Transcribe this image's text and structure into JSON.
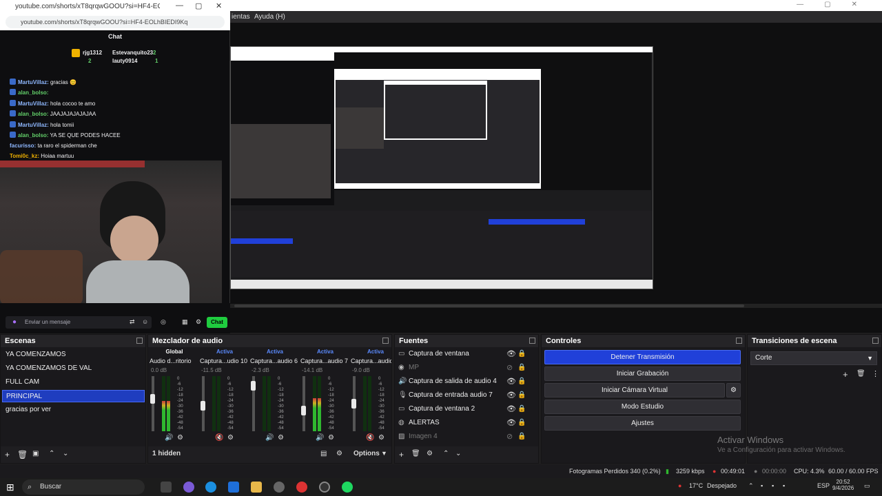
{
  "browser": {
    "url_top": "youtube.com/shorts/xT8qrqwGOOU?si=HF4-EOLhBIEDI9Kq",
    "url": "youtube.com/shorts/xT8qrqwGOOU?si=HF4-EOLhBIEDI9Kq",
    "chat_title": "Chat",
    "subs": [
      {
        "name": "rjg1312",
        "count": "2"
      },
      {
        "name": "Estevanquito23",
        "count": "2"
      },
      {
        "name": "lauty0914",
        "count": "1"
      }
    ],
    "messages": [
      {
        "user": "MartuVillaz:",
        "text": "gracias 😊",
        "green": false
      },
      {
        "user": "alan_bolso:",
        "text": "",
        "green": true
      },
      {
        "user": "MartuVillaz:",
        "text": "hola cocoo te amo",
        "green": false
      },
      {
        "user": "alan_bolso:",
        "text": "JAAJAJAJAJAJAA",
        "green": true
      },
      {
        "user": "MartuVillaz:",
        "text": "hola tomii",
        "green": false
      },
      {
        "user": "alan_bolso:",
        "text": "YA SE QUE PODES HACEE",
        "green": true
      },
      {
        "user": "facurisso:",
        "text": "ta raro el spiderman che",
        "green": false
      },
      {
        "user": "Tomi0c_kz:",
        "text": "Hoiaa martuu",
        "green": false
      }
    ],
    "input_placeholder": "Enviar un mensaje",
    "send_label": "Chat"
  },
  "obs": {
    "menu": {
      "herramientas": "ientas",
      "ayuda": "Ayuda (H)"
    },
    "docks": {
      "scenes": {
        "title": "Escenas",
        "items": [
          "YA COMENZAMOS",
          "YA COMENZAMOS DE VAL",
          "FULL CAM",
          "PRINCIPAL",
          "gracias por ver"
        ],
        "active_index": 3
      },
      "mixer": {
        "title": "Mezclador de audio",
        "tabs": [
          "Global",
          "Activa",
          "Activa",
          "Activa",
          "Activa"
        ],
        "channels": [
          {
            "name": "Audio d...ritorio",
            "db": "0.0 dB",
            "level": 0.55,
            "fader": 0.4
          },
          {
            "name": "Captura...udio 10",
            "db": "-11.5 dB",
            "level": 0.0,
            "fader": 0.55
          },
          {
            "name": "Captura...audio 6",
            "db": "-2.3 dB",
            "level": 0.0,
            "fader": 0.1
          },
          {
            "name": "Captura...audio 7",
            "db": "-14.1 dB",
            "level": 0.6,
            "fader": 0.65
          },
          {
            "name": "Captura...audio 8",
            "db": "-9.0 dB",
            "level": 0.0,
            "fader": 0.5
          }
        ],
        "scale": [
          "0",
          "-6",
          "-12",
          "-18",
          "-24",
          "-30",
          "-36",
          "-42",
          "-48",
          "-54",
          "-60"
        ],
        "hidden": "1 hidden",
        "options": "Options"
      },
      "sources": {
        "title": "Fuentes",
        "items": [
          {
            "label": "Captura de ventana",
            "dim": false
          },
          {
            "label": "MP",
            "dim": true
          },
          {
            "label": "Captura de salida de audio 4",
            "dim": false
          },
          {
            "label": "Captura de entrada audio 7",
            "dim": false
          },
          {
            "label": "Captura de ventana 2",
            "dim": false
          },
          {
            "label": "ALERTAS",
            "dim": false
          },
          {
            "label": "Imagen 4",
            "dim": true
          }
        ]
      },
      "controls": {
        "title": "Controles",
        "buttons": [
          "Detener Transmisión",
          "Iniciar Grabación",
          "Iniciar Cámara Virtual",
          "Modo Estudio",
          "Ajustes"
        ]
      },
      "transitions": {
        "title": "Transiciones de escena",
        "selected": "Corte"
      }
    },
    "watermark": {
      "line1": "Activar Windows",
      "line2": "Ve a Configuración para activar Windows."
    },
    "status": {
      "dropped": "Fotogramas Perdidos 340 (0.2%)",
      "kbps": "3259 kbps",
      "stream_time": "00:49:01",
      "rec_time": "00:00:00",
      "cpu": "CPU: 4.3%",
      "fps": "60.00 / 60.00 FPS"
    }
  },
  "taskbar": {
    "search": "Buscar",
    "weather": "17°C",
    "weather_text": "Despejado",
    "lang": "ESP",
    "time": "20:52",
    "date": "9/4/2026"
  },
  "colors": {
    "obs_accent": "#2040d9",
    "twitch_green": "#1fcc3f",
    "meter_green": "#2fb82f"
  }
}
